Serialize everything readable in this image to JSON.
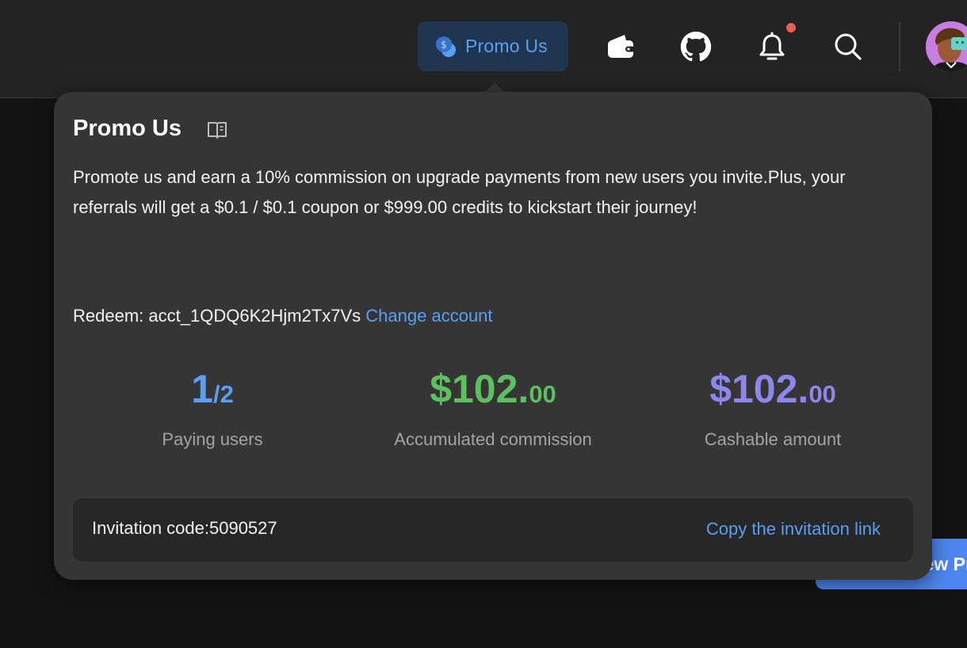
{
  "topbar": {
    "promo_button_label": "Promo Us",
    "icons": [
      "coin-icon",
      "wallet-icon",
      "github-icon",
      "bell-icon",
      "search-icon"
    ],
    "has_notification": true
  },
  "background": {
    "primary_button_label": "New Project"
  },
  "popover": {
    "title": "Promo Us",
    "description": "Promote us and earn a 10% commission on upgrade payments from new users you invite.Plus, your referrals will get a $0.1 / $0.1 coupon or $999.00 credits to kickstart their journey!",
    "redeem_label": "Redeem:",
    "account_id": "acct_1QDQ6K2Hjm2Tx7Vs",
    "change_account_label": "Change account",
    "stats": [
      {
        "value_main": "1",
        "value_small": "/2",
        "caption": "Paying users",
        "color": "#5aa0f2"
      },
      {
        "value_main": "$102.",
        "value_small": "00",
        "caption": "Accumulated commission",
        "color": "#5cc060"
      },
      {
        "value_main": "$102.",
        "value_small": "00",
        "caption": "Cashable amount",
        "color": "#8d86ec"
      }
    ],
    "invitation_code_label": "Invitation code:",
    "invitation_code": "5090527",
    "copy_link_label": "Copy the invitation link"
  },
  "colors": {
    "accent": "#5aa0f2",
    "green": "#5cc060",
    "purple": "#8d86ec",
    "notification": "#ef5a5a"
  }
}
